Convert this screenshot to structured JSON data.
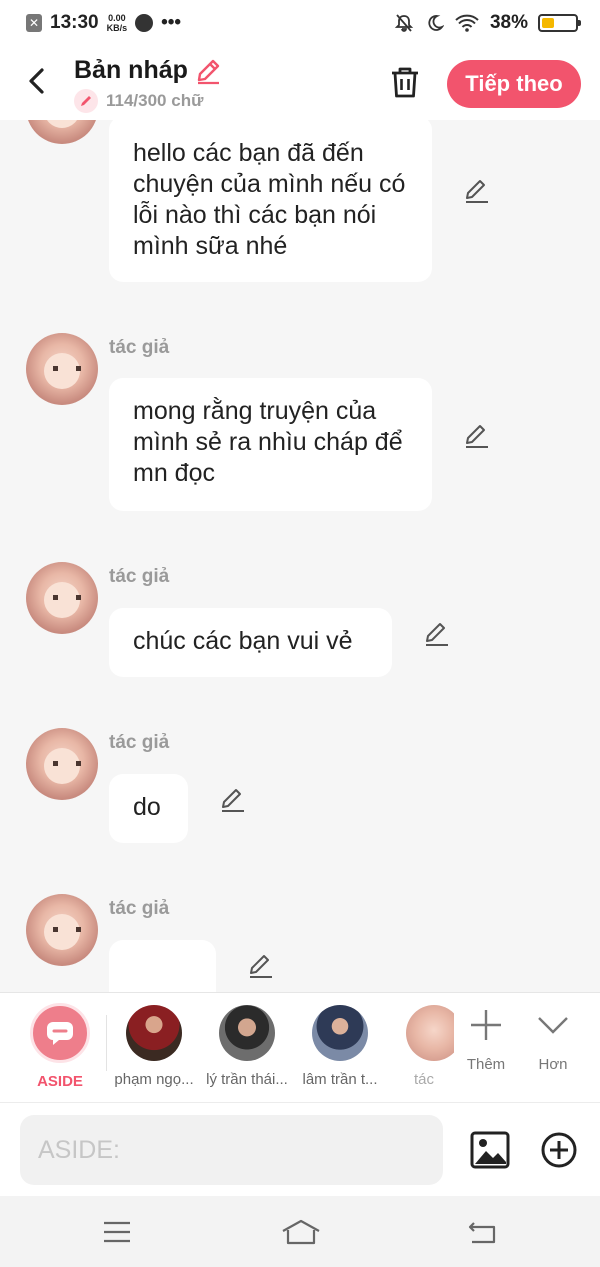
{
  "status_bar": {
    "time": "13:30",
    "speed_value": "0.00",
    "speed_unit": "KB/s",
    "battery_percent": "38%",
    "battery_level": 0.38,
    "battery_color": "#f5b800"
  },
  "header": {
    "title": "Bản nháp",
    "word_count": "114/300 chữ",
    "next_label": "Tiếp theo",
    "accent": "#f2546d"
  },
  "messages": [
    {
      "author": "",
      "text": "hello các bạn đã đến chuyện của mình nếu có lỗi nào thì các bạn nói mình sữa nhé"
    },
    {
      "author": "tác giả",
      "text": "mong rằng truyện của mình sẻ ra nhìu cháp để mn đọc"
    },
    {
      "author": "tác giả",
      "text": "chúc các bạn vui vẻ"
    },
    {
      "author": "tác giả",
      "text": "do"
    },
    {
      "author": "tác giả",
      "text": "____"
    }
  ],
  "characters": [
    {
      "name": "ASIDE",
      "icon": "chat-bubble-icon"
    },
    {
      "name": "phạm ngọ..."
    },
    {
      "name": "lý trần thái..."
    },
    {
      "name": "lâm trần t..."
    },
    {
      "name": "tác"
    }
  ],
  "tools": {
    "add_label": "Thêm",
    "more_label": "Hơn"
  },
  "input": {
    "placeholder": "ASIDE:"
  }
}
